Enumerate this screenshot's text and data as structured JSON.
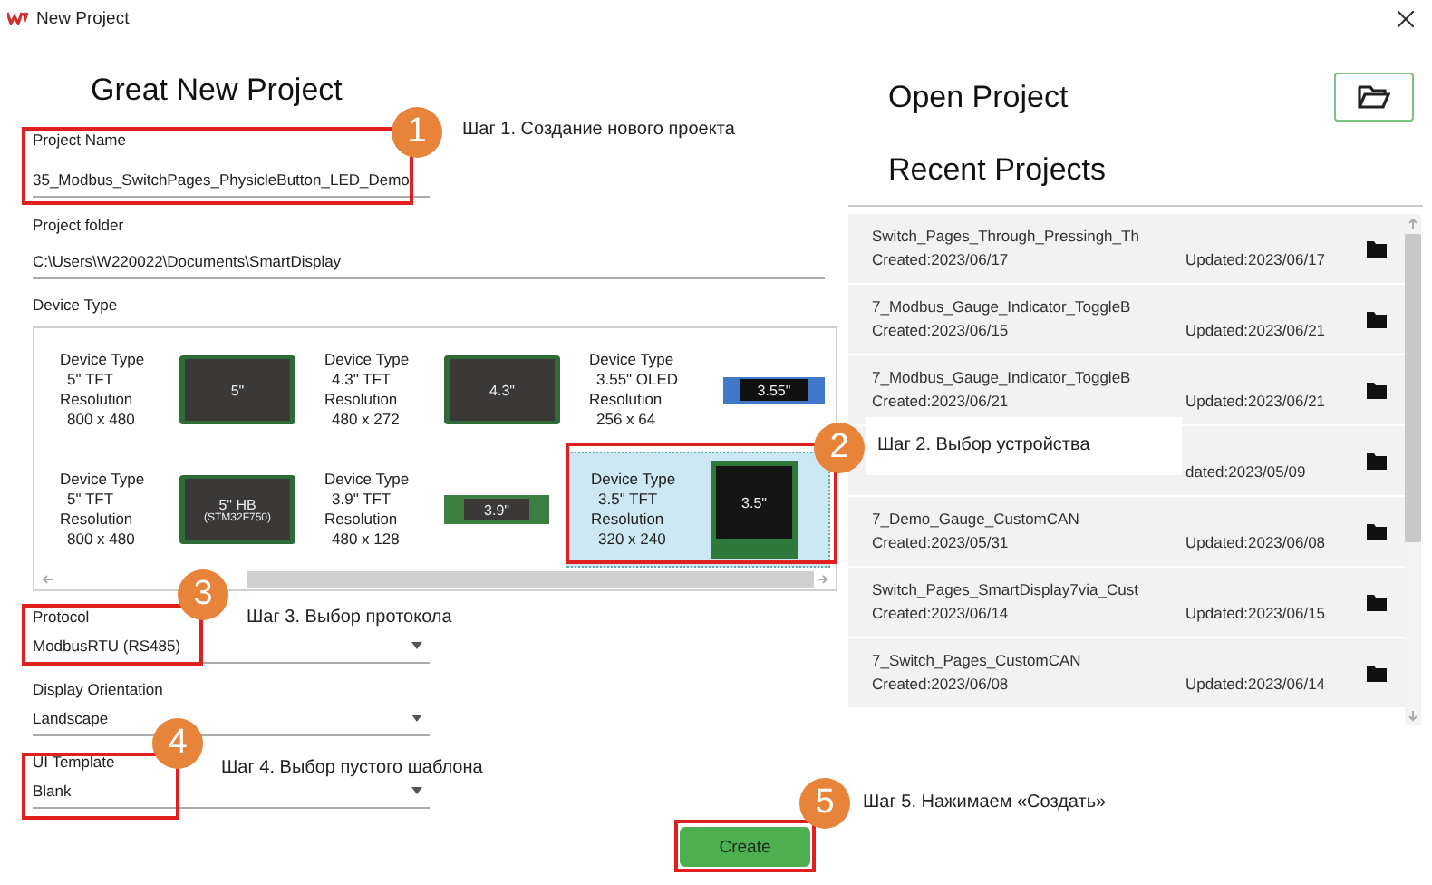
{
  "window": {
    "title": "New Project"
  },
  "create_project": {
    "heading": "Great New Project",
    "top_fields": [
      {
        "label": "Project Name",
        "value": "35_Modbus_SwitchPages_PhysicleButton_LED_Demo",
        "kind": "text"
      },
      {
        "label": "Project folder",
        "value": "C:\\Users\\W220022\\Documents\\SmartDisplay",
        "kind": "text"
      }
    ],
    "device_type": {
      "label": "Device Type",
      "devices": [
        {
          "type_label": "Device Type",
          "type": "5\" TFT",
          "resolution_label": "Resolution",
          "resolution": "800 x 480",
          "screen": "5\"",
          "kind": "panel",
          "selected": false
        },
        {
          "type_label": "Device Type",
          "type": "4.3\" TFT",
          "resolution_label": "Resolution",
          "resolution": "480 x 272",
          "screen": "4.3\"",
          "kind": "panel",
          "selected": false
        },
        {
          "type_label": "Device Type",
          "type": "3.55\" OLED",
          "resolution_label": "Resolution",
          "resolution": "256 x 64",
          "screen": "3.55\"",
          "kind": "oled-strip",
          "selected": false
        },
        {
          "type_label": "Device Type",
          "type": "5\" TFT",
          "resolution_label": "Resolution",
          "resolution": "800 x 480",
          "screen": "5\" HB",
          "screen_note": "(STM32F750)",
          "kind": "panel",
          "selected": false
        },
        {
          "type_label": "Device Type",
          "type": "3.9\" TFT",
          "resolution_label": "Resolution",
          "resolution": "480 x 128",
          "screen": "3.9\"",
          "kind": "strip",
          "selected": false
        },
        {
          "type_label": "Device Type",
          "type": "3.5\" TFT",
          "resolution_label": "Resolution",
          "resolution": "320 x 240",
          "screen": "3.5\"",
          "kind": "square",
          "selected": true
        }
      ]
    },
    "bottom_fields": [
      {
        "label": "Protocol",
        "value": "ModbusRTU (RS485)",
        "kind": "dropdown"
      },
      {
        "label": "Display Orientation",
        "value": "Landscape",
        "kind": "dropdown"
      },
      {
        "label": "UI Template",
        "value": "Blank",
        "kind": "dropdown"
      }
    ],
    "create_button": "Create"
  },
  "open_project": {
    "heading": "Open Project"
  },
  "recent_projects": {
    "heading": "Recent Projects",
    "rows": [
      {
        "name": "Switch_Pages_Through_Pressingh_Th",
        "created": "Created:2023/06/17",
        "updated": "Updated:2023/06/17"
      },
      {
        "name": "7_Modbus_Gauge_Indicator_ToggleB",
        "created": "Created:2023/06/15",
        "updated": "Updated:2023/06/21"
      },
      {
        "name": "7_Modbus_Gauge_Indicator_ToggleB",
        "created": "Created:2023/06/21",
        "updated": "Updated:2023/06/21"
      },
      {
        "updated": "dated:2023/05/09"
      },
      {
        "name": "7_Demo_Gauge_CustomCAN",
        "created": "Created:2023/05/31",
        "updated": "Updated:2023/06/08"
      },
      {
        "name": "Switch_Pages_SmartDisplay7via_Cust",
        "created": "Created:2023/06/14",
        "updated": "Updated:2023/06/15"
      },
      {
        "name": "7_Switch_Pages_CustomCAN",
        "created": "Created:2023/06/08",
        "updated": "Updated:2023/06/14"
      }
    ]
  },
  "annotations": [
    {
      "number": "1",
      "text": "Шаг 1. Создание нового проекта"
    },
    {
      "number": "2",
      "text": "Шаг 2. Выбор устройства"
    },
    {
      "number": "3",
      "text": "Шаг 3. Выбор протокола"
    },
    {
      "number": "4",
      "text": "Шаг 4. Выбор пустого шаблона"
    },
    {
      "number": "5",
      "text": "Шаг 5. Нажимаем «Создать»"
    }
  ]
}
